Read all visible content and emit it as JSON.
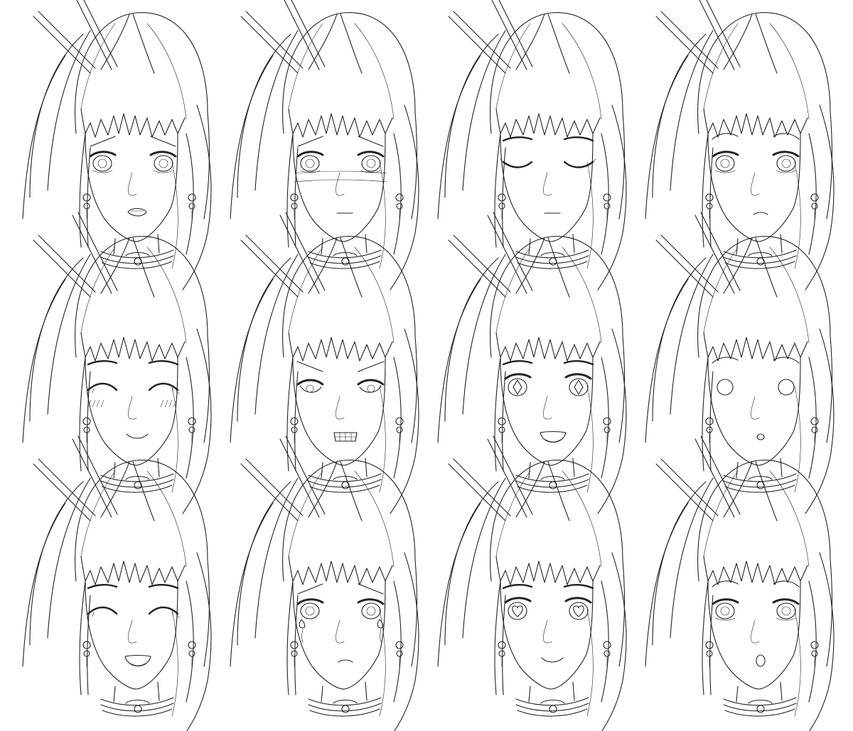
{
  "sheet": {
    "background": "#ffffff",
    "ink_color": "#222222"
  },
  "expressions": [
    {
      "name": "worried-open-mouth",
      "eyes": "open",
      "brows": "worried",
      "mouth": "open-small",
      "extra": "none"
    },
    {
      "name": "sad-flushed",
      "eyes": "open",
      "brows": "worried",
      "mouth": "flat",
      "extra": "nose-band"
    },
    {
      "name": "calm-closed-eyes",
      "eyes": "closed-line",
      "brows": "neutral",
      "mouth": "flat",
      "extra": "none"
    },
    {
      "name": "concerned",
      "eyes": "open",
      "brows": "raised",
      "mouth": "small-frown",
      "extra": "none"
    },
    {
      "name": "blushing-smile",
      "eyes": "closed-happy",
      "brows": "neutral",
      "mouth": "smile",
      "extra": "blush"
    },
    {
      "name": "angry-gritted",
      "eyes": "narrow",
      "brows": "angry",
      "mouth": "gritted",
      "extra": "none"
    },
    {
      "name": "excited-sparkle",
      "eyes": "diamond",
      "brows": "neutral",
      "mouth": "open-smile",
      "extra": "none"
    },
    {
      "name": "shocked-blank",
      "eyes": "blank-circle",
      "brows": "raised",
      "mouth": "small-o",
      "extra": "none"
    },
    {
      "name": "laughing",
      "eyes": "closed-happy",
      "brows": "neutral",
      "mouth": "open-smile",
      "extra": "none"
    },
    {
      "name": "teary",
      "eyes": "teary",
      "brows": "worried",
      "mouth": "small-frown",
      "extra": "tears"
    },
    {
      "name": "in-love",
      "eyes": "heart",
      "brows": "neutral",
      "mouth": "smile",
      "extra": "none"
    },
    {
      "name": "surprised",
      "eyes": "open",
      "brows": "raised",
      "mouth": "o",
      "extra": "none"
    }
  ]
}
